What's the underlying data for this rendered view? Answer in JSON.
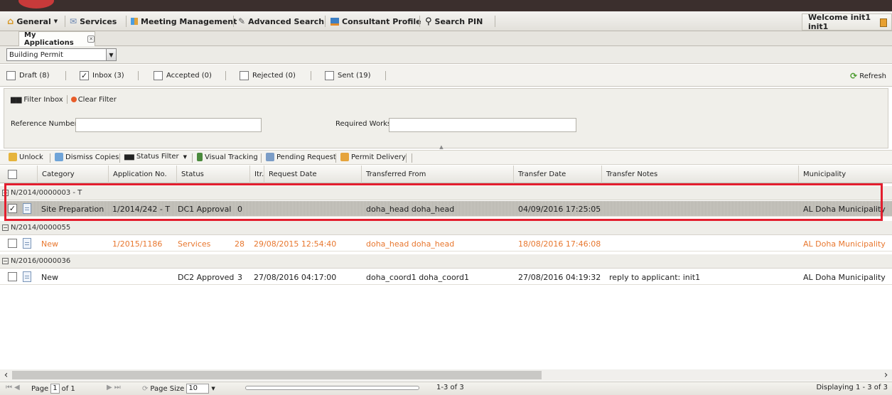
{
  "menu": {
    "general": "General",
    "services": "Services",
    "meeting": "Meeting Management",
    "advanced_search": "Advanced Search",
    "consultant": "Consultant Profile",
    "search_pin": "Search PIN",
    "welcome": "Welcome init1 init1"
  },
  "tab": {
    "label": "My Applications"
  },
  "application_type": {
    "selected": "Building Permit"
  },
  "filters": [
    {
      "label": "Draft (8)",
      "checked": false
    },
    {
      "label": "Inbox (3)",
      "checked": true
    },
    {
      "label": "Accepted (0)",
      "checked": false
    },
    {
      "label": "Rejected (0)",
      "checked": false
    },
    {
      "label": "Sent (19)",
      "checked": false
    }
  ],
  "refresh_label": "Refresh",
  "filter_panel": {
    "filter_inbox": "Filter Inbox",
    "clear_filter": "Clear Filter",
    "reference_label": "Reference Number",
    "reference_value": "",
    "required_works_label": "Required Works",
    "required_works_value": ""
  },
  "grid_toolbar": {
    "unlock": "Unlock",
    "dismiss": "Dismiss Copies",
    "status_filter": "Status Filter",
    "visual_tracking": "Visual Tracking",
    "pending": "Pending Request",
    "permit_delivery": "Permit Delivery"
  },
  "columns": [
    "Category",
    "Application No.",
    "Status",
    "Itr.",
    "Request Date",
    "Transferred From",
    "Transfer Date",
    "Transfer Notes",
    "Municipality"
  ],
  "groups": [
    {
      "label": "N/2014/0000003 - T",
      "rows": [
        {
          "category": "Site Preparation",
          "app_no": "1/2014/242 - T",
          "status": "DC1 Approval",
          "itr": "0",
          "request_date": "",
          "from": "doha_head doha_head",
          "transfer_date": "04/09/2016 17:25:05",
          "notes": "",
          "municipality": "AL Doha Municipality",
          "checked": true,
          "style": "selected"
        }
      ]
    },
    {
      "label": "N/2014/0000055",
      "rows": [
        {
          "category": "New",
          "app_no": "1/2015/1186",
          "status": "Services",
          "itr": "28",
          "request_date": "29/08/2015 12:54:40",
          "from": "doha_head doha_head",
          "transfer_date": "18/08/2016 17:46:08",
          "notes": "",
          "municipality": "AL Doha Municipality",
          "checked": false,
          "style": "orange"
        }
      ]
    },
    {
      "label": "N/2016/0000036",
      "rows": [
        {
          "category": "New",
          "app_no": "",
          "status": "DC2 Approved",
          "itr": "3",
          "request_date": "27/08/2016 04:17:00",
          "from": "doha_coord1 doha_coord1",
          "transfer_date": "27/08/2016 04:19:32",
          "notes": "reply to applicant: init1",
          "municipality": "AL Doha Municipality",
          "checked": false,
          "style": "normal"
        }
      ]
    }
  ],
  "pager": {
    "page_label": "Page",
    "page_value": "1",
    "of_label": "of 1",
    "page_size_label": "Page Size",
    "page_size_value": "10",
    "range": "1-3 of 3",
    "displaying": "Displaying 1 - 3 of 3"
  }
}
